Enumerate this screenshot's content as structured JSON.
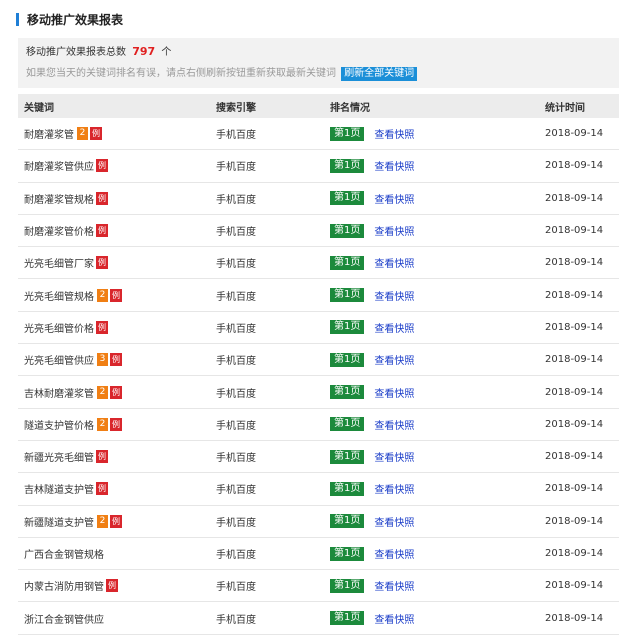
{
  "header": {
    "title": "移动推广效果报表"
  },
  "summary": {
    "prefix": "移动推广效果报表总数",
    "count": "797",
    "unit": "个",
    "hint": "如果您当天的关键词排名有误，请点右侧刷新按钮重新获取最新关键词",
    "refresh_label": "刷新全部关键词"
  },
  "columns": [
    "关键词",
    "搜索引擎",
    "排名情况",
    "统计时间"
  ],
  "snapshot_label": "查看快照",
  "rows": [
    {
      "keyword": "耐磨灌浆管",
      "num": "2",
      "flag": "例",
      "engine": "手机百度",
      "rank": "第1页",
      "date": "2018-09-14"
    },
    {
      "keyword": "耐磨灌浆管供应",
      "num": "",
      "flag": "例",
      "engine": "手机百度",
      "rank": "第1页",
      "date": "2018-09-14"
    },
    {
      "keyword": "耐磨灌浆管规格",
      "num": "",
      "flag": "例",
      "engine": "手机百度",
      "rank": "第1页",
      "date": "2018-09-14"
    },
    {
      "keyword": "耐磨灌浆管价格",
      "num": "",
      "flag": "例",
      "engine": "手机百度",
      "rank": "第1页",
      "date": "2018-09-14"
    },
    {
      "keyword": "光亮毛细管厂家",
      "num": "",
      "flag": "例",
      "engine": "手机百度",
      "rank": "第1页",
      "date": "2018-09-14"
    },
    {
      "keyword": "光亮毛细管规格",
      "num": "2",
      "flag": "例",
      "engine": "手机百度",
      "rank": "第1页",
      "date": "2018-09-14"
    },
    {
      "keyword": "光亮毛细管价格",
      "num": "",
      "flag": "例",
      "engine": "手机百度",
      "rank": "第1页",
      "date": "2018-09-14"
    },
    {
      "keyword": "光亮毛细管供应",
      "num": "3",
      "flag": "例",
      "engine": "手机百度",
      "rank": "第1页",
      "date": "2018-09-14"
    },
    {
      "keyword": "吉林耐磨灌浆管",
      "num": "2",
      "flag": "例",
      "engine": "手机百度",
      "rank": "第1页",
      "date": "2018-09-14"
    },
    {
      "keyword": "隧道支护管价格",
      "num": "2",
      "flag": "例",
      "engine": "手机百度",
      "rank": "第1页",
      "date": "2018-09-14"
    },
    {
      "keyword": "新疆光亮毛细管",
      "num": "",
      "flag": "例",
      "engine": "手机百度",
      "rank": "第1页",
      "date": "2018-09-14"
    },
    {
      "keyword": "吉林隧道支护管",
      "num": "",
      "flag": "例",
      "engine": "手机百度",
      "rank": "第1页",
      "date": "2018-09-14"
    },
    {
      "keyword": "新疆隧道支护管",
      "num": "2",
      "flag": "例",
      "engine": "手机百度",
      "rank": "第1页",
      "date": "2018-09-14"
    },
    {
      "keyword": "广西合金钢管规格",
      "num": "",
      "flag": "",
      "engine": "手机百度",
      "rank": "第1页",
      "date": "2018-09-14"
    },
    {
      "keyword": "内蒙古消防用钢管",
      "num": "",
      "flag": "例",
      "engine": "手机百度",
      "rank": "第1页",
      "date": "2018-09-14"
    },
    {
      "keyword": "浙江合金钢管供应",
      "num": "",
      "flag": "",
      "engine": "手机百度",
      "rank": "第1页",
      "date": "2018-09-14"
    }
  ],
  "colors": {
    "accent": "#1f7fd6",
    "rank_green": "#1c8a3c",
    "badge_orange": "#f07f14",
    "badge_red": "#d9262c",
    "link_blue": "#1a3cc8"
  }
}
